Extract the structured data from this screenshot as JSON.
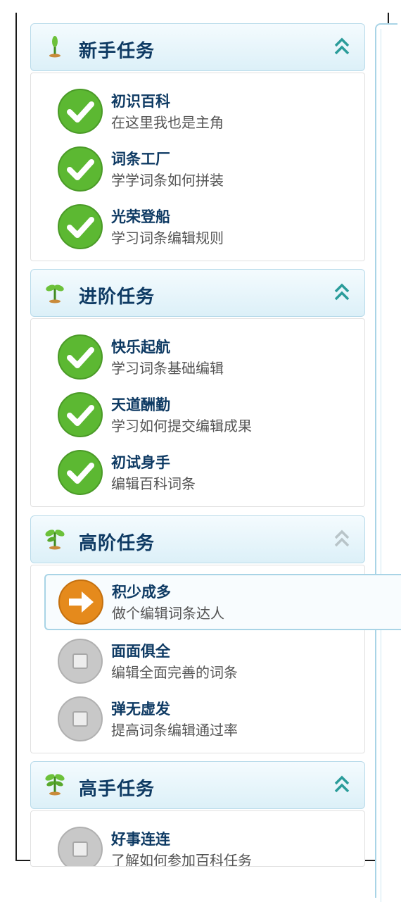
{
  "colors": {
    "header_text": "#0e3a63",
    "done_green": "#5cb832",
    "active_orange": "#e58a1c",
    "pending_gray": "#bdbdbd",
    "border_blue": "#a9d4e6"
  },
  "sections": [
    {
      "title": "新手任务",
      "icon": "sprout-icon",
      "toggle": "collapse-chevron-icon",
      "tasks": [
        {
          "title": "初识百科",
          "desc": "在这里我也是主角",
          "status": "done"
        },
        {
          "title": "词条工厂",
          "desc": "学学词条如何拼装",
          "status": "done"
        },
        {
          "title": "光荣登船",
          "desc": "学习词条编辑规则",
          "status": "done"
        }
      ]
    },
    {
      "title": "进阶任务",
      "icon": "seedling-icon",
      "toggle": "collapse-chevron-icon",
      "tasks": [
        {
          "title": "快乐起航",
          "desc": "学习词条基础编辑",
          "status": "done"
        },
        {
          "title": "天道酬勤",
          "desc": "学习如何提交编辑成果",
          "status": "done"
        },
        {
          "title": "初试身手",
          "desc": "编辑百科词条",
          "status": "done"
        }
      ]
    },
    {
      "title": "高阶任务",
      "icon": "young-plant-icon",
      "toggle": "collapse-chevron-icon",
      "tasks": [
        {
          "title": "积少成多",
          "desc": "做个编辑词条达人",
          "status": "active"
        },
        {
          "title": "面面俱全",
          "desc": "编辑全面完善的词条",
          "status": "pending"
        },
        {
          "title": "弹无虚发",
          "desc": "提高词条编辑通过率",
          "status": "pending"
        }
      ]
    },
    {
      "title": "高手任务",
      "icon": "tree-icon",
      "toggle": "collapse-chevron-icon",
      "tasks": [
        {
          "title": "好事连连",
          "desc": "了解如何参加百科任务",
          "status": "pending"
        }
      ]
    }
  ]
}
